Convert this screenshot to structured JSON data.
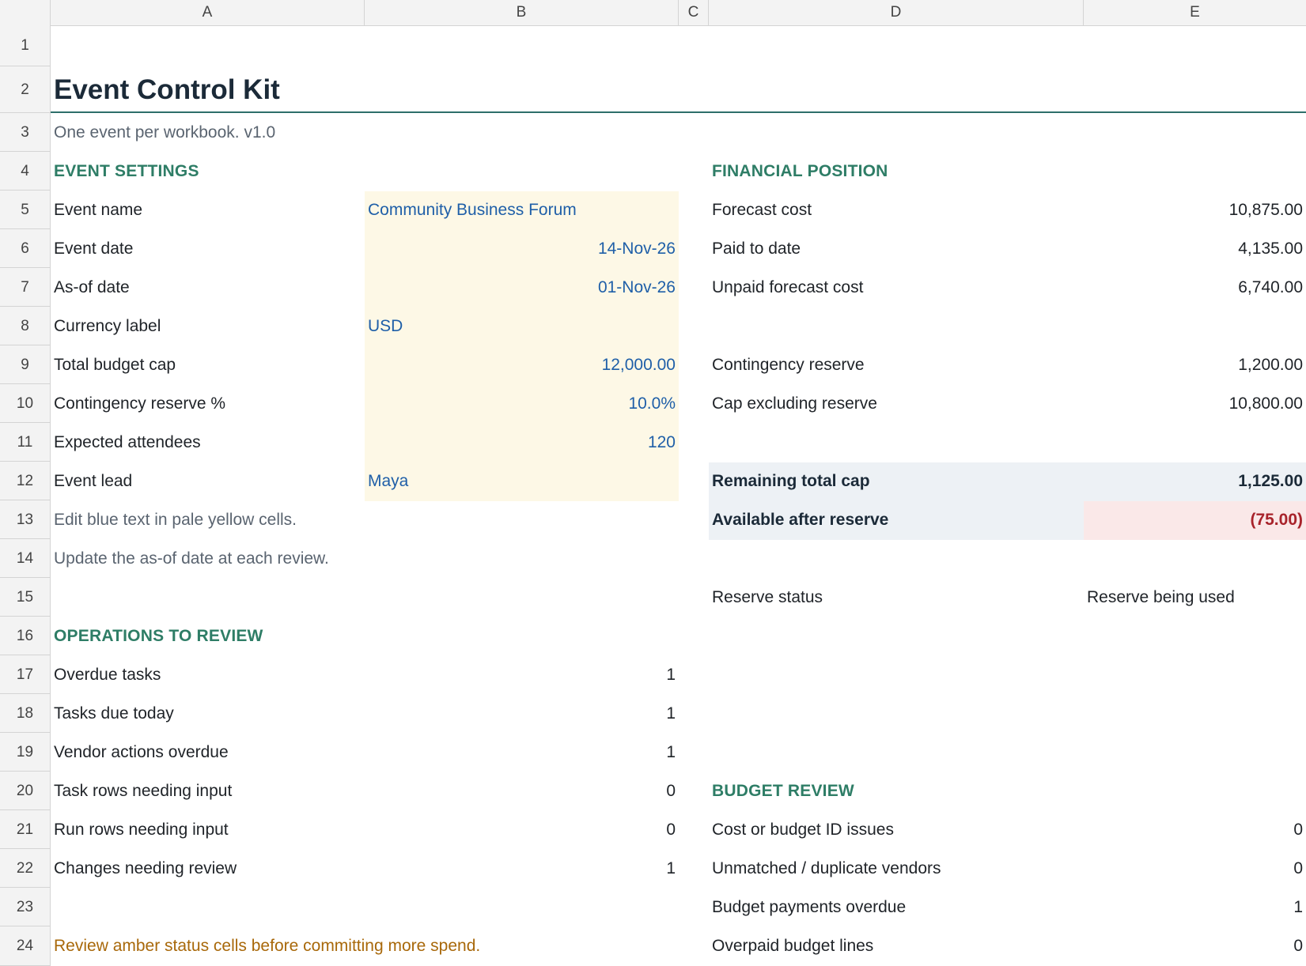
{
  "columns": [
    "A",
    "B",
    "C",
    "D",
    "E"
  ],
  "rows": [
    "1",
    "2",
    "3",
    "4",
    "5",
    "6",
    "7",
    "8",
    "9",
    "10",
    "11",
    "12",
    "13",
    "14",
    "15",
    "16",
    "17",
    "18",
    "19",
    "20",
    "21",
    "22",
    "23",
    "24"
  ],
  "header": {
    "title": "Event Control Kit",
    "subtitle": "One event per workbook. v1.0"
  },
  "event_settings": {
    "heading": "EVENT SETTINGS",
    "items": [
      {
        "label": "Event name",
        "value": "Community Business Forum"
      },
      {
        "label": "Event date",
        "value": "14-Nov-26"
      },
      {
        "label": "As-of date",
        "value": "01-Nov-26"
      },
      {
        "label": "Currency label",
        "value": "USD"
      },
      {
        "label": "Total budget cap",
        "value": "12,000.00"
      },
      {
        "label": "Contingency reserve %",
        "value": "10.0%"
      },
      {
        "label": "Expected attendees",
        "value": "120"
      },
      {
        "label": "Event lead",
        "value": "Maya"
      }
    ],
    "note_1": "Edit blue text in pale yellow cells.",
    "note_2": "Update the as-of date at each review."
  },
  "financial_position": {
    "heading": "FINANCIAL POSITION",
    "forecast_cost_label": "Forecast cost",
    "forecast_cost_value": "10,875.00",
    "paid_label": "Paid to date",
    "paid_value": "4,135.00",
    "unpaid_label": "Unpaid forecast cost",
    "unpaid_value": "6,740.00",
    "reserve_label": "Contingency reserve",
    "reserve_value": "1,200.00",
    "cap_ex_label": "Cap excluding reserve",
    "cap_ex_value": "10,800.00",
    "remaining_label": "Remaining total cap",
    "remaining_value": "1,125.00",
    "available_label": "Available after reserve",
    "available_value": "(75.00)",
    "status_label": "Reserve status",
    "status_value": "Reserve being used"
  },
  "operations": {
    "heading": "OPERATIONS TO REVIEW",
    "items": [
      {
        "label": "Overdue tasks",
        "value": "1"
      },
      {
        "label": "Tasks due today",
        "value": "1"
      },
      {
        "label": "Vendor actions overdue",
        "value": "1"
      },
      {
        "label": "Task rows needing input",
        "value": "0"
      },
      {
        "label": "Run rows needing input",
        "value": "0"
      },
      {
        "label": "Changes needing review",
        "value": "1"
      }
    ],
    "warning": "Review amber status cells before committing more spend."
  },
  "budget_review": {
    "heading": "BUDGET REVIEW",
    "items": [
      {
        "label": "Cost or budget ID issues",
        "value": "0"
      },
      {
        "label": "Unmatched / duplicate vendors",
        "value": "0"
      },
      {
        "label": "Budget payments overdue",
        "value": "1"
      },
      {
        "label": "Overpaid budget lines",
        "value": "0"
      }
    ]
  },
  "colors": {
    "section": "#2e7d66",
    "input_text": "#1f5fa8",
    "input_fill": "#fdf8e6",
    "negative": "#a8232b",
    "amber": "#a8680a"
  }
}
